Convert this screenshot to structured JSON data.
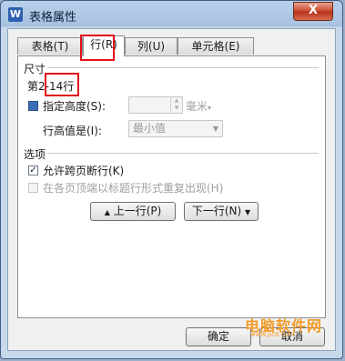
{
  "window": {
    "title": "表格属性",
    "app_icon": "W",
    "close": "X"
  },
  "tabs": [
    {
      "label": "表格(T)"
    },
    {
      "label": "行(R)"
    },
    {
      "label": "列(U)"
    },
    {
      "label": "单元格(E)"
    }
  ],
  "size_section": {
    "title": "尺寸",
    "row_info": "第2-14行",
    "specify_height_label": "指定高度(S):",
    "height_value": "",
    "unit": "毫米",
    "row_height_label": "行高值是(I):",
    "row_height_value": "最小值"
  },
  "options_section": {
    "title": "选项",
    "allow_break_label": "允许跨页断行(K)",
    "repeat_header_label": "在各页顶端以标题行形式重复出现(H)",
    "prev_row_label": "上一行(P)",
    "next_row_label": "下一行(N)"
  },
  "footer": {
    "ok_label": "确定",
    "cancel_label": "取消"
  },
  "watermark": {
    "text": "电脑软件网",
    "sub": "www.pc6.com"
  },
  "colors": {
    "highlight": "#e0101a",
    "checkbox_fill": "#3a6fb5"
  }
}
